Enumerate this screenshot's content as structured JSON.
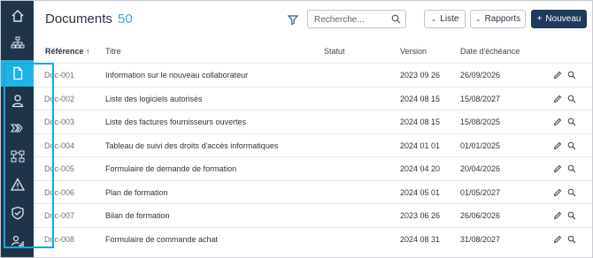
{
  "sidebar": {
    "items": [
      {
        "icon": "home-icon"
      },
      {
        "icon": "org-chart-icon"
      },
      {
        "icon": "document-icon",
        "active": true
      },
      {
        "icon": "user-icon"
      },
      {
        "icon": "process-arrows-icon"
      },
      {
        "icon": "hierarchy-icon"
      },
      {
        "icon": "warning-icon"
      },
      {
        "icon": "shield-check-icon"
      },
      {
        "icon": "user-chart-icon"
      }
    ]
  },
  "header": {
    "title": "Documents",
    "separator": "-",
    "count": "50",
    "search_placeholder": "Recherche...",
    "list_label": "Liste",
    "reports_label": "Rapports",
    "new_label": "Nouveau",
    "new_prefix": "+"
  },
  "table": {
    "columns": [
      "Référence ↑",
      "Titre",
      "Statut",
      "Version",
      "Date d'échéance"
    ],
    "rows": [
      {
        "ref": "Doc-001",
        "title": "Information sur le nouveau collaborateur",
        "status": "",
        "version": "2023 09 26",
        "due": "26/09/2026"
      },
      {
        "ref": "Doc-002",
        "title": "Liste des logiciels autorisés",
        "status": "",
        "version": "2024 08 15",
        "due": "15/08/2027"
      },
      {
        "ref": "Doc-003",
        "title": "Liste des factures fournisseurs ouvertes",
        "status": "",
        "version": "2024 08 15",
        "due": "15/08/2025"
      },
      {
        "ref": "Doc-004",
        "title": "Tableau de suivi des droits d'accès informatiques",
        "status": "",
        "version": "2024 01 01",
        "due": "01/01/2025"
      },
      {
        "ref": "Doc-005",
        "title": "Formulaire de demande de formation",
        "status": "",
        "version": "2024 04 20",
        "due": "20/04/2026"
      },
      {
        "ref": "Doc-006",
        "title": "Plan de formation",
        "status": "",
        "version": "2024 05 01",
        "due": "01/05/2027"
      },
      {
        "ref": "Doc-007",
        "title": "Bilan de formation",
        "status": "",
        "version": "2023 06 26",
        "due": "26/06/2026"
      },
      {
        "ref": "Doc-008",
        "title": "Formulaire de commande achat",
        "status": "",
        "version": "2024 08 31",
        "due": "31/08/2027"
      }
    ]
  },
  "colors": {
    "sidebar": "#1f3449",
    "accent": "#1fb3e6",
    "primary": "#1f3a5c",
    "highlight": "#18a8e0"
  }
}
